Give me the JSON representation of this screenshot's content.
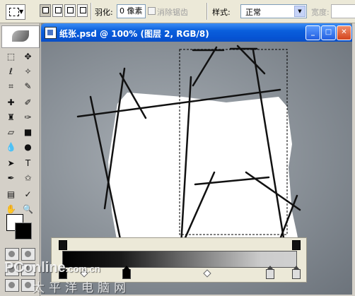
{
  "options_bar": {
    "feather_label": "羽化:",
    "feather_value": "0 像素",
    "antialias_label": "消除锯齿",
    "style_label": "样式:",
    "style_value": "正常",
    "width_label": "宽度:"
  },
  "document": {
    "title": "纸张.psd @ 100% (图层 2, RGB/8)"
  },
  "watermark": {
    "brand": "PConline",
    "domain": ".com.cn",
    "tagline": "太平洋电脑网"
  },
  "colors": {
    "foreground": "#ffffff",
    "background": "#000000",
    "title_bar": "#0a5fdc"
  }
}
